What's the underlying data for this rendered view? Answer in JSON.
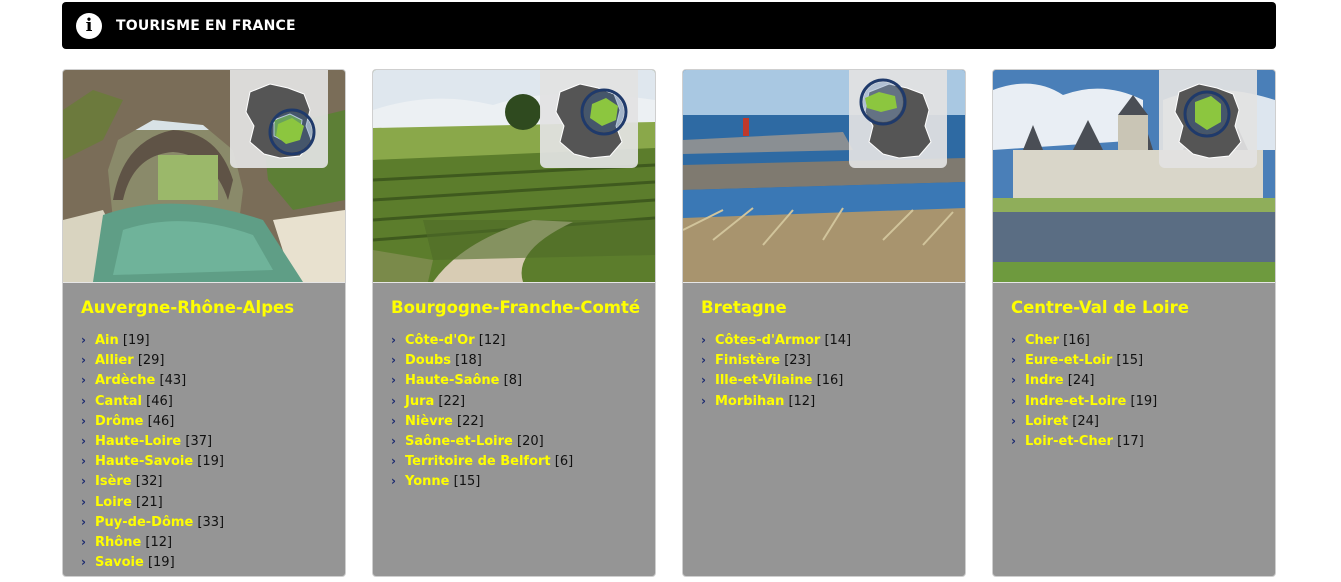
{
  "header": {
    "title": "TOURISME EN FRANCE",
    "icon": "info-icon"
  },
  "colors": {
    "accent": "#ffff00",
    "card_bg": "#959595",
    "header_bg": "#000000",
    "map_region": "#8cc63f",
    "map_gray": "#555555"
  },
  "regions": [
    {
      "title": "Auvergne-Rhône-Alpes",
      "departments": [
        {
          "name": "Ain",
          "count": "[19]"
        },
        {
          "name": "Allier",
          "count": "[29]"
        },
        {
          "name": "Ardèche",
          "count": "[43]"
        },
        {
          "name": "Cantal",
          "count": "[46]"
        },
        {
          "name": "Drôme",
          "count": "[46]"
        },
        {
          "name": "Haute-Loire",
          "count": "[37]"
        },
        {
          "name": "Haute-Savoie",
          "count": "[19]"
        },
        {
          "name": "Isère",
          "count": "[32]"
        },
        {
          "name": "Loire",
          "count": "[21]"
        },
        {
          "name": "Puy-de-Dôme",
          "count": "[33]"
        },
        {
          "name": "Rhône",
          "count": "[12]"
        },
        {
          "name": "Savoie",
          "count": "[19]"
        }
      ]
    },
    {
      "title": "Bourgogne-Franche-Comté",
      "departments": [
        {
          "name": "Côte-d'Or",
          "count": "[12]"
        },
        {
          "name": "Doubs",
          "count": "[18]"
        },
        {
          "name": "Haute-Saône",
          "count": "[8]"
        },
        {
          "name": "Jura",
          "count": "[22]"
        },
        {
          "name": "Nièvre",
          "count": "[22]"
        },
        {
          "name": "Saône-et-Loire",
          "count": "[20]"
        },
        {
          "name": "Territoire de Belfort",
          "count": "[6]"
        },
        {
          "name": "Yonne",
          "count": "[15]"
        }
      ]
    },
    {
      "title": "Bretagne",
      "departments": [
        {
          "name": "Côtes-d'Armor",
          "count": "[14]"
        },
        {
          "name": "Finistère",
          "count": "[23]"
        },
        {
          "name": "Ille-et-Vilaine",
          "count": "[16]"
        },
        {
          "name": "Morbihan",
          "count": "[12]"
        }
      ]
    },
    {
      "title": "Centre-Val de Loire",
      "departments": [
        {
          "name": "Cher",
          "count": "[16]"
        },
        {
          "name": "Eure-et-Loir",
          "count": "[15]"
        },
        {
          "name": "Indre",
          "count": "[24]"
        },
        {
          "name": "Indre-et-Loire",
          "count": "[19]"
        },
        {
          "name": "Loiret",
          "count": "[24]"
        },
        {
          "name": "Loir-et-Cher",
          "count": "[17]"
        }
      ]
    }
  ]
}
